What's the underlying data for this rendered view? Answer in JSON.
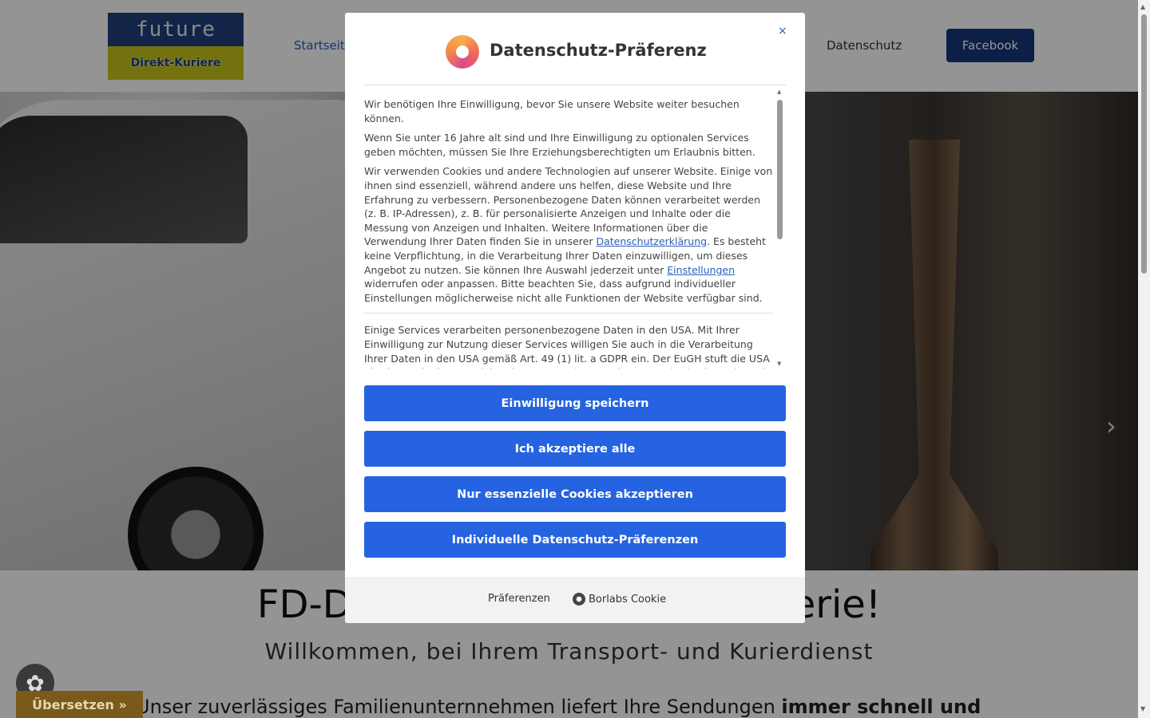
{
  "header": {
    "logo_top": "future",
    "logo_bottom": "Direkt-Kuriere",
    "nav": {
      "start": "Startseite",
      "datenschutz": "Datenschutz",
      "facebook": "Facebook"
    }
  },
  "hero": {
    "next_arrow": "›"
  },
  "intro": {
    "title": "FD-Direkt-Kuriere – Ihre Kurierie!",
    "subtitle": "Willkommen, bei Ihrem Transport- und Kurierdienst",
    "text_prefix": "Unser zuverlässiges Familienunternnehmen liefert Ihre Sendungen ",
    "text_bold": "immer schnell und"
  },
  "widgets": {
    "translate": "Übersetzen »"
  },
  "modal": {
    "title": "Datenschutz-Präferenz",
    "close": "×",
    "para1": "Wir benötigen Ihre Einwilligung, bevor Sie unsere Website weiter besuchen können.",
    "para2": "Wenn Sie unter 16 Jahre alt sind und Ihre Einwilligung zu optionalen Services geben möchten, müssen Sie Ihre Erziehungsberechtigten um Erlaubnis bitten.",
    "para3_a": "Wir verwenden Cookies und andere Technologien auf unserer Website. Einige von ihnen sind essenziell, während andere uns helfen, diese Website und Ihre Erfahrung zu verbessern. Personenbezogene Daten können verarbeitet werden (z. B. IP-Adressen), z. B. für personalisierte Anzeigen und Inhalte oder die Messung von Anzeigen und Inhalten. Weitere Informationen über die Verwendung Ihrer Daten finden Sie in unserer ",
    "para3_link1": "Datenschutzerklärung",
    "para3_b": ". Es besteht keine Verpflichtung, in die Verarbeitung Ihrer Daten einzuwilligen, um dieses Angebot zu nutzen. Sie können Ihre Auswahl jederzeit unter ",
    "para3_link2": "Einstellungen",
    "para3_c": " widerrufen oder anpassen. Bitte beachten Sie, dass aufgrund individueller Einstellungen möglicherweise nicht alle Funktionen der Website verfügbar sind.",
    "para4": "Einige Services verarbeiten personenbezogene Daten in den USA. Mit Ihrer Einwilligung zur Nutzung dieser Services willigen Sie auch in die Verarbeitung Ihrer Daten in den USA gemäß Art. 49 (1) lit. a GDPR ein. Der EuGH stuft die USA als ein Land mit unzureichendem Datenschutz nach EU-Standards ein. Es besteht",
    "buttons": {
      "save": "Einwilligung speichern",
      "accept_all": "Ich akzeptiere alle",
      "essential": "Nur essenzielle Cookies akzeptieren",
      "individual": "Individuelle Datenschutz-Präferenzen"
    },
    "footer": {
      "preferences": "Präferenzen",
      "borlabs": "Borlabs Cookie"
    }
  }
}
